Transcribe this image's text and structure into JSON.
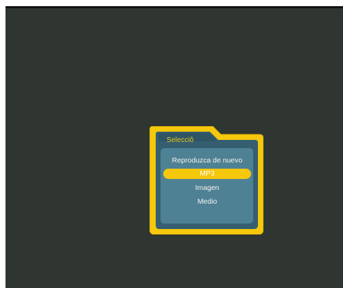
{
  "dialog": {
    "title": "Selecciô",
    "items": [
      {
        "label": "Reproduzca de nuevo",
        "selected": false
      },
      {
        "label": "MP3",
        "selected": true
      },
      {
        "label": "Imagen",
        "selected": false
      },
      {
        "label": "Medio",
        "selected": false
      }
    ]
  },
  "colors": {
    "background": "#2f3530",
    "frame_yellow": "#f5c80c",
    "panel_teal": "#4e8194",
    "panel_dark": "#355f70",
    "title_text": "#f2d21c",
    "item_text": "#f4f4f0"
  }
}
